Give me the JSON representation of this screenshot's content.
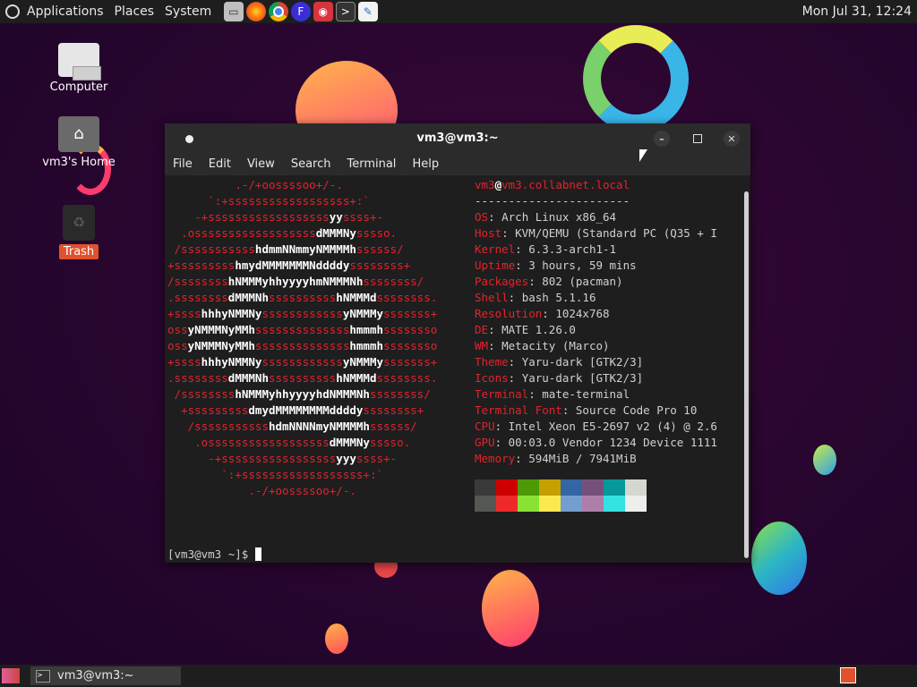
{
  "top_panel": {
    "menus": [
      "Applications",
      "Places",
      "System"
    ],
    "launchers": [
      "file-manager-icon",
      "firefox-icon",
      "chrome-icon",
      "app-icon",
      "screenshot-icon",
      "terminal-icon",
      "text-editor-icon"
    ],
    "clock": "Mon Jul 31, 12:24"
  },
  "desktop": {
    "icons": [
      {
        "label": "Computer"
      },
      {
        "label": "vm3's Home"
      },
      {
        "label": "Trash"
      }
    ]
  },
  "window": {
    "title": "vm3@vm3:~",
    "menu": [
      "File",
      "Edit",
      "View",
      "Search",
      "Terminal",
      "Help"
    ]
  },
  "terminal": {
    "host_user": "vm3",
    "host_at": "@",
    "host_name": "vm3.collabnet.local",
    "separator": "-----------------------",
    "info": [
      {
        "key": "OS",
        "value": "Arch Linux x86_64"
      },
      {
        "key": "Host",
        "value": "KVM/QEMU (Standard PC (Q35 + I"
      },
      {
        "key": "Kernel",
        "value": "6.3.3-arch1-1"
      },
      {
        "key": "Uptime",
        "value": "3 hours, 59 mins"
      },
      {
        "key": "Packages",
        "value": "802 (pacman)"
      },
      {
        "key": "Shell",
        "value": "bash 5.1.16"
      },
      {
        "key": "Resolution",
        "value": "1024x768"
      },
      {
        "key": "DE",
        "value": "MATE 1.26.0"
      },
      {
        "key": "WM",
        "value": "Metacity (Marco)"
      },
      {
        "key": "Theme",
        "value": "Yaru-dark [GTK2/3]"
      },
      {
        "key": "Icons",
        "value": "Yaru-dark [GTK2/3]"
      },
      {
        "key": "Terminal",
        "value": "mate-terminal"
      },
      {
        "key": "Terminal Font",
        "value": "Source Code Pro 10"
      },
      {
        "key": "CPU",
        "value": "Intel Xeon E5-2697 v2 (4) @ 2.6"
      },
      {
        "key": "GPU",
        "value": "00:03.0 Vendor 1234 Device 1111"
      },
      {
        "key": "Memory",
        "value": "594MiB / 7941MiB"
      }
    ],
    "logo": [
      "          .-/+oossssoo+/-.",
      "      `:+ssssssssssssssssss+:`",
      "    -+ssssssssssssssssssyyssss+-",
      "  .ossssssssssssssssssdMMMNysssso.",
      " /ssssssssssshdmmNNmmyNMMMMhssssss/",
      "+ssssssssshmydMMMMMMMNddddyssssssss+",
      "/sssssssshNMMMyhhyyyyhmNMMMNhssssssss/",
      ".ssssssssdMMMNhsssssssssshNMMMdssssssss.",
      "+sssshhhyNMMNyssssssssssssyNMMMysssssss+",
      "ossyNMMMNyMMhsssssssssssssshmmmhssssssso",
      "ossyNMMMNyMMhsssssssssssssshmmmhssssssso",
      "+sssshhhyNMMNyssssssssssssyNMMMysssssss+",
      ".ssssssssdMMMNhsssssssssshNMMMdssssssss.",
      " /sssssssshNMMMyhhyyyyhdNMMMNhssssssss/",
      "  +sssssssssdmydMMMMMMMMddddyssssssss+",
      "   /ssssssssssshdmNNNNmyNMMMMhssssss/",
      "    .ossssssssssssssssssdMMMNysssso.",
      "      -+sssssssssssssssssyyyssss+-",
      "        `:+ssssssssssssssssss+:`",
      "            .-/+oossssoo+/-."
    ],
    "palette_top": [
      "#3a3a3a",
      "#cc0000",
      "#4e9a06",
      "#c4a000",
      "#3465a4",
      "#75507b",
      "#06989a",
      "#d3d7cf"
    ],
    "palette_bottom": [
      "#555753",
      "#ef2929",
      "#8ae234",
      "#fce94f",
      "#729fcf",
      "#ad7fa8",
      "#34e2e2",
      "#eeeeec"
    ],
    "prompt": "[vm3@vm3 ~]$ "
  },
  "bottom_panel": {
    "task": "vm3@vm3:~"
  }
}
